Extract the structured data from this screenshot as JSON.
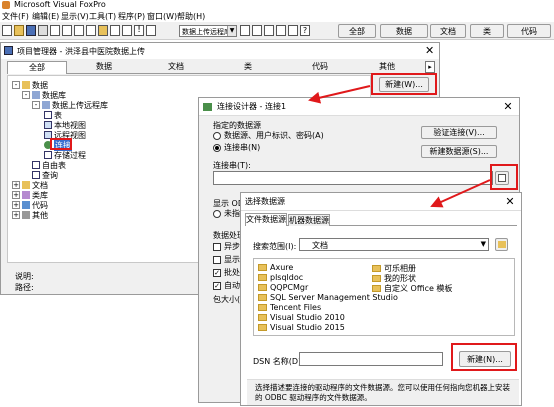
{
  "app": {
    "title": "Microsoft Visual FoxPro"
  },
  "menu": [
    "文件(F)",
    "编辑(E)",
    "显示(V)",
    "工具(T)",
    "程序(P)",
    "窗口(W)",
    "帮助(H)"
  ],
  "toolbar": {
    "combo_value": "数据上传远程库",
    "tabs": [
      "全部",
      "数据",
      "文档",
      "类",
      "代码"
    ]
  },
  "project": {
    "title": "项目管理器 - 洪泽县中医院数据上传",
    "tabs": [
      "全部",
      "数据",
      "文档",
      "类",
      "代码",
      "其他"
    ],
    "new_button": "新建(W)...",
    "tree": [
      "数据",
      "数据库",
      "数据上传远程库",
      "表",
      "本地视图",
      "远程视图",
      "连接",
      "存储过程",
      "自由表",
      "查询",
      "文档",
      "类库",
      "代码",
      "其他"
    ],
    "footer": {
      "desc_label": "说明:",
      "path_label": "路径:"
    }
  },
  "conn_designer": {
    "title": "连接设计器 - 连接1",
    "datasource_group": "指定的数据源",
    "option1": "数据源、用户标识、密码(A)",
    "option2": "连接串(N)",
    "verify_button": "验证连接(V)...",
    "new_ds_button": "新建数据源(S)...",
    "connstr_label": "连接串(T):",
    "display_label": "显示 ODBC",
    "display_option": "未指定",
    "data_processing_label": "数据处理",
    "chk1": "异步执",
    "chk2": "显示警",
    "chk3": "批处理",
    "chk4": "自动事",
    "packet_label": "包大小(K"
  },
  "select_ds": {
    "title": "选择数据源",
    "tabs": [
      "文件数据源",
      "机器数据源"
    ],
    "search_label": "搜索范围(I):",
    "search_value": "文档",
    "folders_left": [
      "Axure",
      "plsqldoc",
      "QQPCMgr",
      "SQL Server Management Studio",
      "Tencent Files",
      "Visual Studio 2010",
      "Visual Studio 2015"
    ],
    "folders_right": [
      "可乐相册",
      "我的形状",
      "自定义 Office 模板"
    ],
    "dsn_label": "DSN 名称(D):",
    "new_button": "新建(N)...",
    "description": "选择描述要连接的驱动程序的文件数据源。您可以使用任何指向您机器上安装的 ODBC 驱动程序的文件数据源。"
  }
}
